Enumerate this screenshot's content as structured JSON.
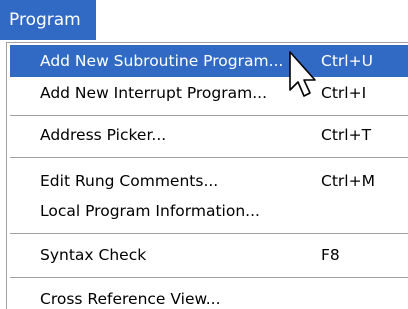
{
  "menu": {
    "title": "Program"
  },
  "items": [
    {
      "label": "Add New Subroutine Program...",
      "shortcut": "Ctrl+U"
    },
    {
      "label": "Add New Interrupt Program...",
      "shortcut": "Ctrl+I"
    },
    {
      "label": "Address Picker...",
      "shortcut": "Ctrl+T"
    },
    {
      "label": "Edit Rung Comments...",
      "shortcut": "Ctrl+M"
    },
    {
      "label": "Local Program Information...",
      "shortcut": ""
    },
    {
      "label": "Syntax Check",
      "shortcut": "F8"
    },
    {
      "label": "Cross Reference View...",
      "shortcut": ""
    }
  ],
  "colors": {
    "highlight": "#316ac5",
    "separator": "#a0a0a0"
  },
  "icons": {
    "cursor": "mouse-pointer-icon"
  }
}
